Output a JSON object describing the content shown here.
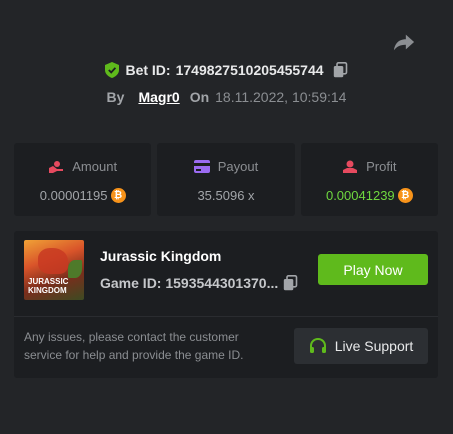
{
  "bet": {
    "label": "Bet ID:",
    "id": "1749827510205455744",
    "by_label": "By",
    "user": "Magr0",
    "on_label": "On",
    "datetime": "18.11.2022, 10:59:14"
  },
  "stats": {
    "amount": {
      "label": "Amount",
      "value": "0.00001195",
      "coin": "₿"
    },
    "payout": {
      "label": "Payout",
      "value": "35.5096 x"
    },
    "profit": {
      "label": "Profit",
      "value": "0.00041239",
      "coin": "₿"
    }
  },
  "game": {
    "title": "Jurassic Kingdom",
    "id_text": "Game ID: 1593544301370...",
    "thumb_line1": "JURASSIC",
    "thumb_line2": "KINGDOM",
    "play_label": "Play Now"
  },
  "support": {
    "text": "Any issues, please contact the customer service for help and provide the game ID.",
    "button_label": "Live Support"
  },
  "colors": {
    "accent_green": "#5fba1c",
    "profit_green": "#6fd83f",
    "bitcoin": "#f7931a"
  },
  "icons": [
    "share-icon",
    "shield-check-icon",
    "copy-icon",
    "amount-icon",
    "payout-icon",
    "profit-icon",
    "bitcoin-icon",
    "headset-icon"
  ]
}
